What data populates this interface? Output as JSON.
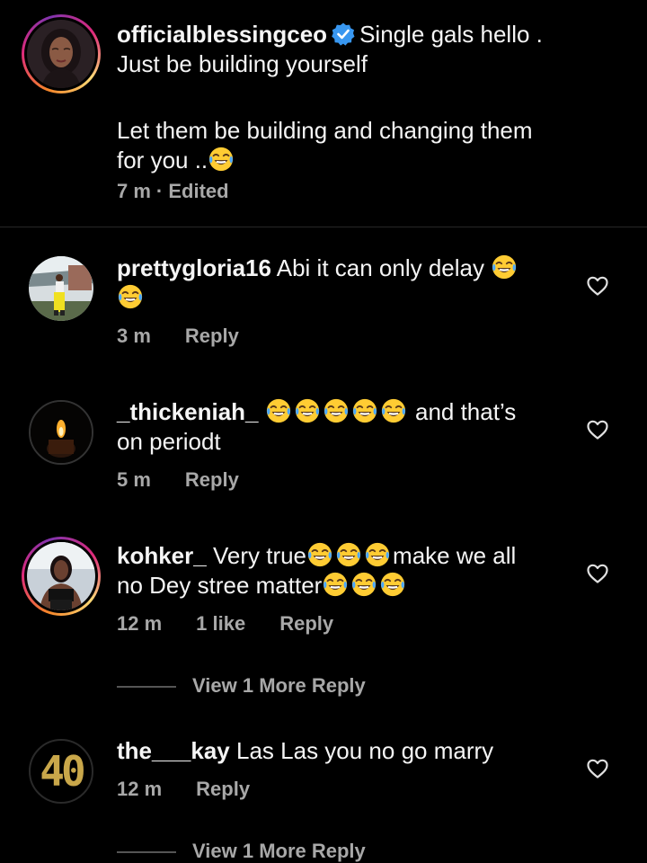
{
  "caption": {
    "username": "officialblessingceo",
    "verified": true,
    "line1": "Single gals hello .",
    "line2": "Just be building yourself",
    "line3": "Let them be building and changing them",
    "line4": "for you ..",
    "time": "7 m",
    "edited": "· Edited"
  },
  "comments": [
    {
      "username": "prettygloria16",
      "text": "Abi it can only delay",
      "time": "3 m",
      "reply": "Reply"
    },
    {
      "username": "_thickeniah_",
      "text_after_emojis": "and that’s",
      "line2": "on periodt",
      "time": "5 m",
      "reply": "Reply"
    },
    {
      "username": "kohker_",
      "text1": "Very true",
      "text2": "make we all",
      "line2": "no Dey stree matter",
      "time": "12 m",
      "likes": "1 like",
      "reply": "Reply"
    },
    {
      "username": "the___kay",
      "text": "Las Las you no go marry",
      "avatar_text": "40",
      "time": "12 m",
      "reply": "Reply"
    }
  ],
  "view_more": {
    "label": "View 1 More Reply"
  },
  "icons": {
    "emoji": "face-with-tears-of-joy-icon",
    "verified": "verified-badge-icon",
    "like": "heart-outline-icon"
  },
  "colors": {
    "background": "#000000",
    "text": "#f5f5f5",
    "meta": "#a8a8a8",
    "verified": "#3897f0",
    "avatar_40": "#c9a74a"
  }
}
